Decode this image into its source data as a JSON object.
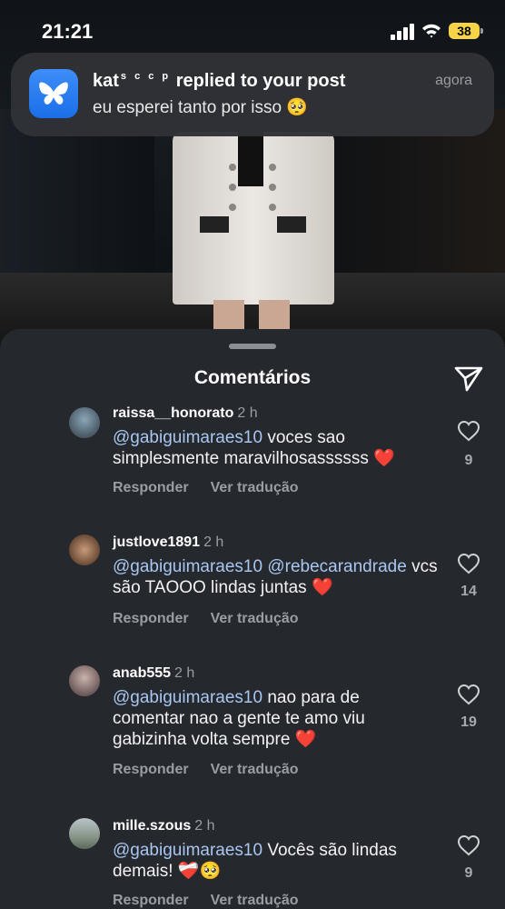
{
  "status_bar": {
    "time": "21:21",
    "battery": "38"
  },
  "notification": {
    "app_icon": "butterfly-icon",
    "sender": "kat",
    "sender_suffix": "s c c p",
    "action": "replied to your post",
    "message": "eu esperei tanto por isso 🥺",
    "time": "agora",
    "colors": {
      "icon_bg": "#1b6ee8"
    }
  },
  "sheet": {
    "title": "Comentários",
    "send_icon": "send-icon"
  },
  "comments": [
    {
      "username": "raissa__honorato",
      "ago": "2 h",
      "mentions": [
        "@gabiguimaraes10"
      ],
      "text": "voces sao simplesmente maravilhosassssss ❤️",
      "reply_label": "Responder",
      "translate_label": "Ver tradução",
      "likes": "9"
    },
    {
      "username": "justlove1891",
      "ago": "2 h",
      "mentions": [
        "@gabiguimaraes10",
        "@rebecarandrade"
      ],
      "text": "vcs são TAOOO lindas juntas ❤️",
      "reply_label": "Responder",
      "translate_label": "Ver tradução",
      "likes": "14"
    },
    {
      "username": "anab555",
      "ago": "2 h",
      "mentions": [
        "@gabiguimaraes10"
      ],
      "text": "nao para de comentar nao a gente te amo viu gabizinha volta sempre ❤️",
      "reply_label": "Responder",
      "translate_label": "Ver tradução",
      "likes": "19"
    },
    {
      "username": "mille.szous",
      "ago": "2 h",
      "mentions": [
        "@gabiguimaraes10"
      ],
      "text": "Vocês são lindas demais! ❤️‍🩹🥺",
      "reply_label": "Responder",
      "translate_label": "Ver tradução",
      "likes": "9"
    }
  ]
}
